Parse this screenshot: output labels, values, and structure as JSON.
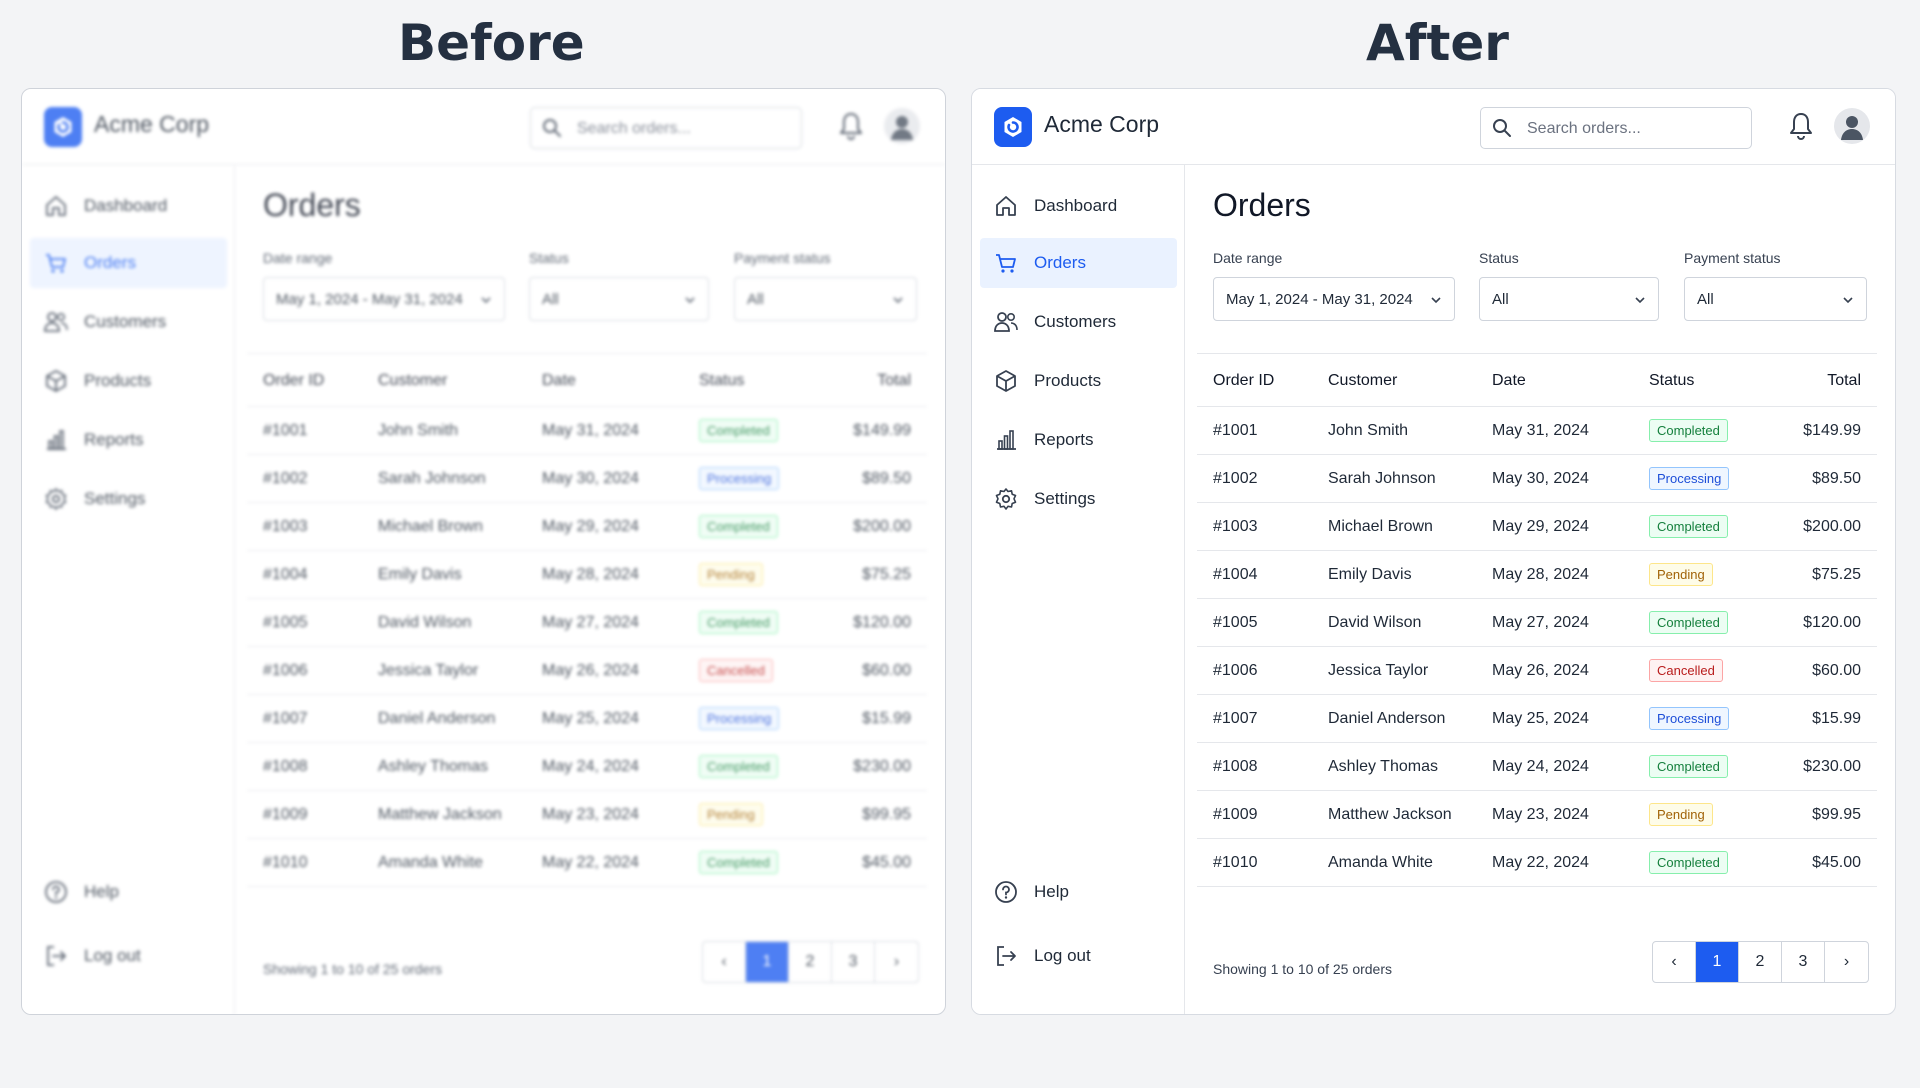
{
  "headings": {
    "before": "Before",
    "after": "After"
  },
  "brand": "Acme Corp",
  "search": {
    "placeholder": "Search orders..."
  },
  "sidebar": {
    "items": [
      {
        "label": "Dashboard",
        "icon": "home-icon"
      },
      {
        "label": "Orders",
        "icon": "cart-icon",
        "active": true
      },
      {
        "label": "Customers",
        "icon": "users-icon"
      },
      {
        "label": "Products",
        "icon": "box-icon"
      },
      {
        "label": "Reports",
        "icon": "bar-chart-icon"
      },
      {
        "label": "Settings",
        "icon": "gear-icon"
      }
    ],
    "help": "Help",
    "logout": "Log out"
  },
  "page": {
    "title": "Orders"
  },
  "filters": {
    "date_label": "Date range",
    "date_value": "May 1, 2024 - May 31, 2024",
    "status_label": "Status",
    "status_value": "All",
    "payment_label": "Payment status",
    "payment_value": "All"
  },
  "table": {
    "columns": [
      "Order ID",
      "Customer",
      "Date",
      "Status",
      "Total"
    ],
    "rows": [
      {
        "id": "#1001",
        "customer": "John Smith",
        "date": "May 31, 2024",
        "status": "Completed",
        "total": "$149.99"
      },
      {
        "id": "#1002",
        "customer": "Sarah Johnson",
        "date": "May 30, 2024",
        "status": "Processing",
        "total": "$89.50"
      },
      {
        "id": "#1003",
        "customer": "Michael Brown",
        "date": "May 29, 2024",
        "status": "Completed",
        "total": "$200.00"
      },
      {
        "id": "#1004",
        "customer": "Emily Davis",
        "date": "May 28, 2024",
        "status": "Pending",
        "total": "$75.25"
      },
      {
        "id": "#1005",
        "customer": "David Wilson",
        "date": "May 27, 2024",
        "status": "Completed",
        "total": "$120.00"
      },
      {
        "id": "#1006",
        "customer": "Jessica Taylor",
        "date": "May 26, 2024",
        "status": "Cancelled",
        "total": "$60.00"
      },
      {
        "id": "#1007",
        "customer": "Daniel Anderson",
        "date": "May 25, 2024",
        "status": "Processing",
        "total": "$15.99"
      },
      {
        "id": "#1008",
        "customer": "Ashley Thomas",
        "date": "May 24, 2024",
        "status": "Completed",
        "total": "$230.00"
      },
      {
        "id": "#1009",
        "customer": "Matthew Jackson",
        "date": "May 23, 2024",
        "status": "Pending",
        "total": "$99.95"
      },
      {
        "id": "#1010",
        "customer": "Amanda White",
        "date": "May 22, 2024",
        "status": "Completed",
        "total": "$45.00"
      }
    ]
  },
  "footer": {
    "showing": "Showing 1 to 10 of 25 orders"
  },
  "pagination": {
    "prev": "‹",
    "pages": [
      "1",
      "2",
      "3"
    ],
    "next": "›",
    "current": "1"
  },
  "colors": {
    "accent": "#1d5cf0",
    "completed": "#15803d",
    "processing": "#1d4ed8",
    "pending": "#a16207",
    "cancelled": "#b91c1c"
  }
}
